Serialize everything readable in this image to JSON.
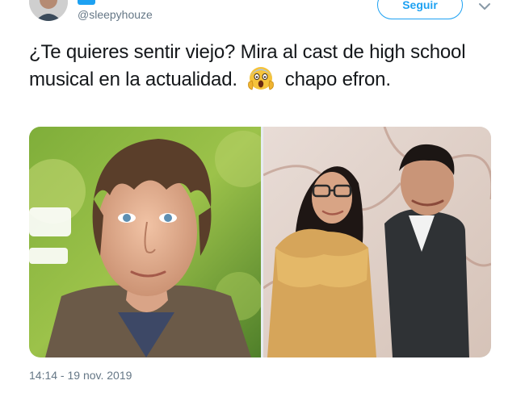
{
  "tweet": {
    "handle": "@sleepyhouze",
    "follow_label": "Seguir",
    "text_part1": "¿Te quieres sentir viejo? Mira al cast de high school musical en la actualidad.",
    "text_part2": "chapo efron.",
    "emoji": "face-screaming-in-fear-icon",
    "timestamp": "14:14 - 19 nov. 2019"
  },
  "colors": {
    "accent": "#1da1f2",
    "muted": "#657786",
    "text": "#14171a"
  }
}
